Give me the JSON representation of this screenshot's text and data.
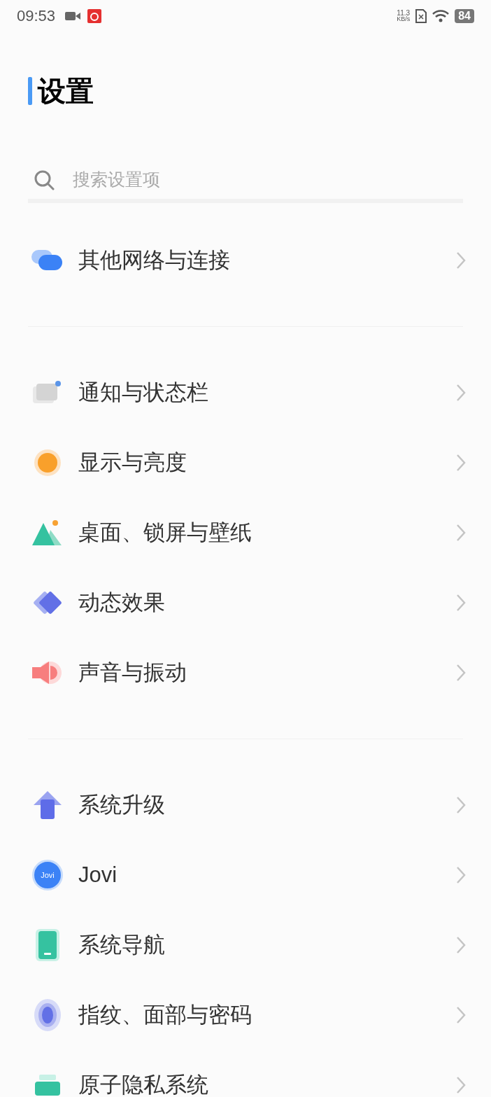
{
  "status_bar": {
    "time": "09:53",
    "net_speed": "11.3",
    "net_unit": "KB/s",
    "battery": "84"
  },
  "title": "设置",
  "search": {
    "placeholder": "搜索设置项"
  },
  "groups": [
    {
      "items": [
        {
          "label": "其他网络与连接",
          "kind": "network"
        }
      ]
    },
    {
      "items": [
        {
          "label": "通知与状态栏",
          "kind": "notification"
        },
        {
          "label": "显示与亮度",
          "kind": "display"
        },
        {
          "label": "桌面、锁屏与壁纸",
          "kind": "wallpaper"
        },
        {
          "label": "动态效果",
          "kind": "motion"
        },
        {
          "label": "声音与振动",
          "kind": "sound"
        }
      ]
    },
    {
      "items": [
        {
          "label": "系统升级",
          "kind": "upgrade"
        },
        {
          "label": "Jovi",
          "kind": "jovi",
          "icon_text": "Jovi"
        },
        {
          "label": "系统导航",
          "kind": "navigation"
        },
        {
          "label": "指纹、面部与密码",
          "kind": "fingerprint"
        },
        {
          "label": "原子隐私系统",
          "kind": "privacy"
        }
      ]
    }
  ]
}
